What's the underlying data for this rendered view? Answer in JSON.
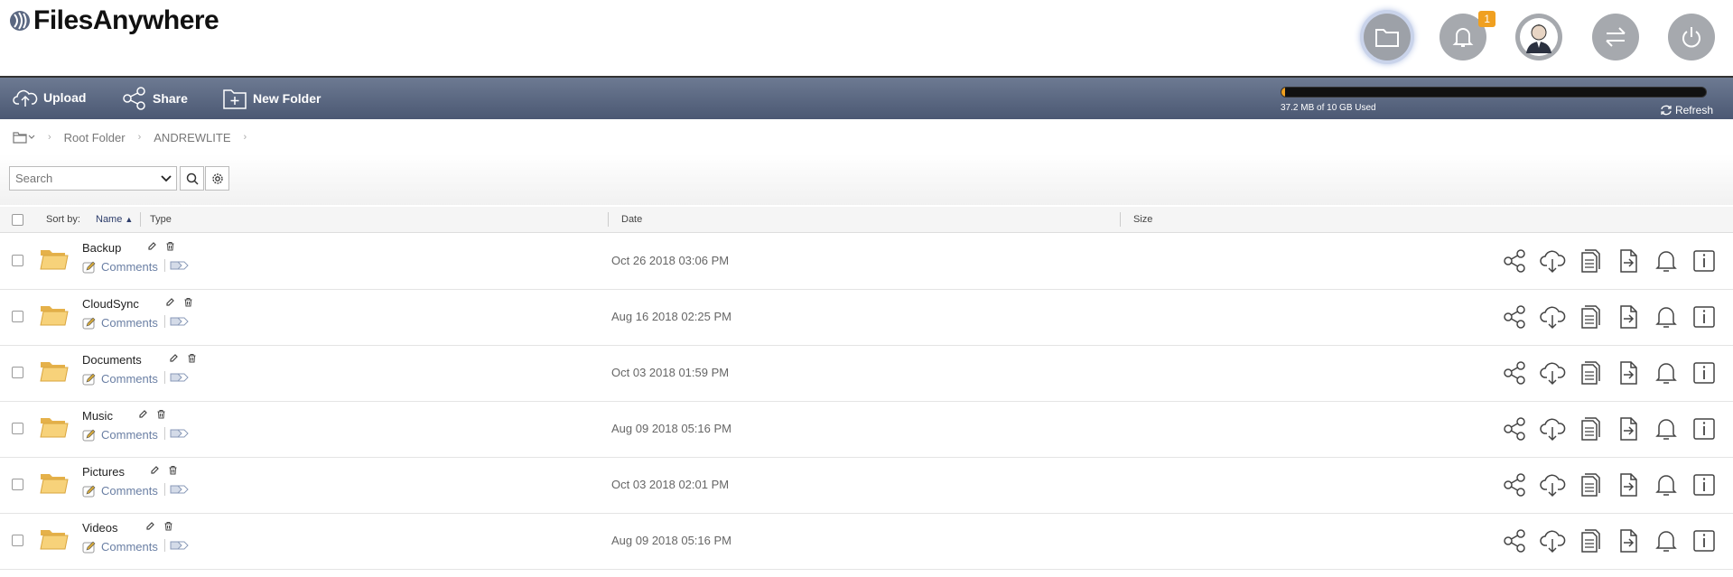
{
  "brand": {
    "name": "FilesAnywhere"
  },
  "header": {
    "buttons": [
      {
        "name": "folders-icon"
      },
      {
        "name": "notifications-icon",
        "badge": "1"
      },
      {
        "name": "profile-avatar-icon"
      },
      {
        "name": "transfer-icon"
      },
      {
        "name": "power-icon"
      }
    ]
  },
  "toolbar": {
    "upload_label": "Upload",
    "share_label": "Share",
    "new_folder_label": "New Folder",
    "quota_text": "37.2 MB of 10 GB Used",
    "quota_fraction": 0.0037,
    "refresh_label": "Refresh"
  },
  "breadcrumb": {
    "items": [
      "Root Folder",
      "ANDREWLITE"
    ]
  },
  "search": {
    "placeholder": "Search"
  },
  "list": {
    "sort_label": "Sort by:",
    "columns": {
      "name": "Name",
      "type": "Type",
      "date": "Date",
      "size": "Size"
    },
    "comments_label": "Comments",
    "rows": [
      {
        "name": "Backup",
        "date": "Oct 26 2018 03:06 PM"
      },
      {
        "name": "CloudSync",
        "date": "Aug 16 2018 02:25 PM"
      },
      {
        "name": "Documents",
        "date": "Oct 03 2018 01:59 PM"
      },
      {
        "name": "Music",
        "date": "Aug 09 2018 05:16 PM"
      },
      {
        "name": "Pictures",
        "date": "Oct 03 2018 02:01 PM"
      },
      {
        "name": "Videos",
        "date": "Aug 09 2018 05:16 PM"
      }
    ]
  },
  "colors": {
    "toolbar": "#5a6781",
    "accent": "#f0a020",
    "link": "#6a7fa4"
  }
}
